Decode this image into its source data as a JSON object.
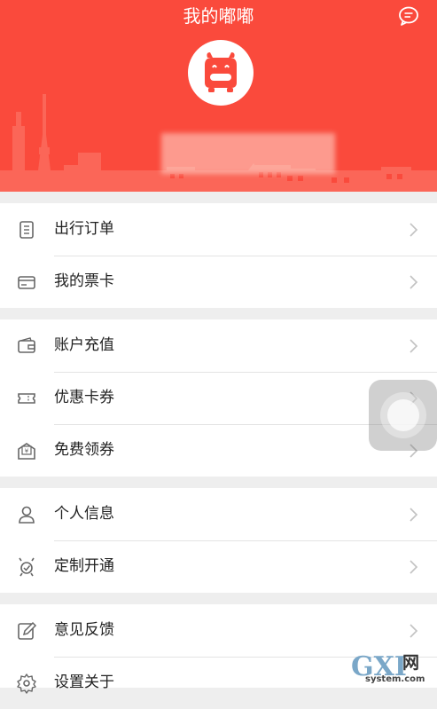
{
  "header": {
    "title": "我的嘟嘟",
    "message_icon": "chat-bubble-icon",
    "avatar_icon": "car-mascot-icon",
    "username": ""
  },
  "colors": {
    "brand": "#fa4a3c",
    "text": "#222222",
    "icon": "#666666",
    "chevron": "#c2c2c2",
    "background": "#eeeeee"
  },
  "menu": {
    "sections": [
      {
        "items": [
          {
            "label": "出行订单",
            "icon": "order-list-icon"
          },
          {
            "label": "我的票卡",
            "icon": "ticket-card-icon"
          }
        ]
      },
      {
        "items": [
          {
            "label": "账户充值",
            "icon": "wallet-icon"
          },
          {
            "label": "优惠卡券",
            "icon": "coupon-icon"
          },
          {
            "label": "免费领券",
            "icon": "free-coupon-icon"
          }
        ]
      },
      {
        "items": [
          {
            "label": "个人信息",
            "icon": "person-icon"
          },
          {
            "label": "定制开通",
            "icon": "custom-route-icon"
          }
        ]
      },
      {
        "items": [
          {
            "label": "意见反馈",
            "icon": "edit-icon"
          },
          {
            "label": "设置关于",
            "icon": "gear-icon"
          }
        ]
      }
    ]
  },
  "watermark": {
    "big": "GXI",
    "cn": "网",
    "small": "system.com"
  }
}
